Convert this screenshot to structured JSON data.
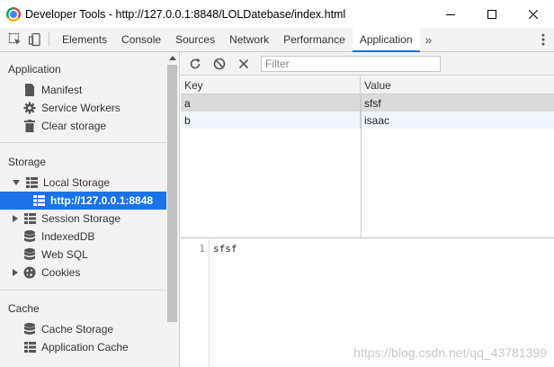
{
  "window": {
    "title": "Developer Tools - http://127.0.0.1:8848/LOLDatebase/index.html"
  },
  "toolbar": {
    "tabs": [
      {
        "label": "Elements"
      },
      {
        "label": "Console"
      },
      {
        "label": "Sources"
      },
      {
        "label": "Network"
      },
      {
        "label": "Performance"
      },
      {
        "label": "Application"
      }
    ],
    "more_label": "»"
  },
  "sidebar": {
    "application": {
      "title": "Application",
      "items": [
        {
          "label": "Manifest",
          "icon": "document-icon"
        },
        {
          "label": "Service Workers",
          "icon": "gear-icon"
        },
        {
          "label": "Clear storage",
          "icon": "trash-icon"
        }
      ]
    },
    "storage": {
      "title": "Storage",
      "local_storage": "Local Storage",
      "local_storage_origin": "http://127.0.0.1:8848",
      "session_storage": "Session Storage",
      "indexeddb": "IndexedDB",
      "websql": "Web SQL",
      "cookies": "Cookies"
    },
    "cache": {
      "title": "Cache",
      "cache_storage": "Cache Storage",
      "application_cache": "Application Cache"
    }
  },
  "main": {
    "filter_placeholder": "Filter",
    "columns": {
      "key": "Key",
      "value": "Value"
    },
    "rows": [
      {
        "key": "a",
        "value": "sfsf"
      },
      {
        "key": "b",
        "value": "isaac"
      }
    ],
    "preview": {
      "line_number": "1",
      "text": "sfsf"
    }
  },
  "watermark": "https://blog.csdn.net/qq_43781399",
  "colors": {
    "accent": "#1a73e8",
    "selected_row": "#dadada",
    "alt_row": "#f0f6fe"
  }
}
